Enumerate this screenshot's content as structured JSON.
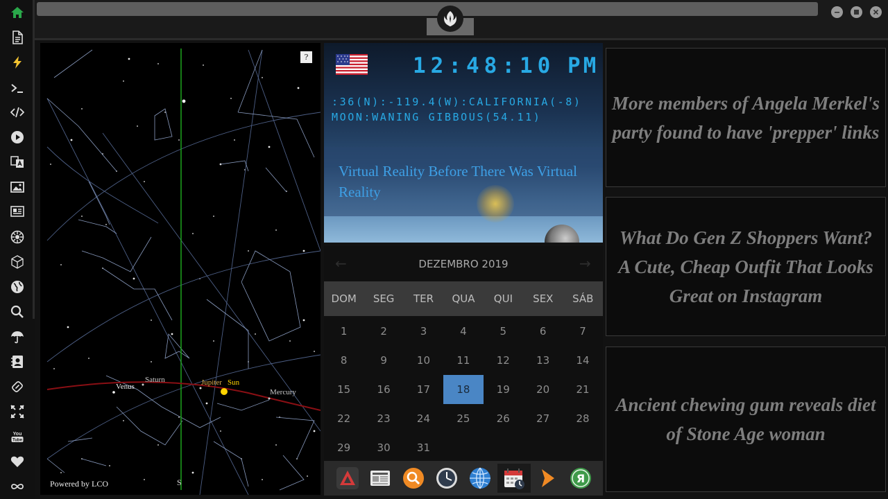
{
  "sidebar": {
    "icons": [
      "home-icon",
      "file-icon",
      "bolt-icon",
      "terminal-icon",
      "code-icon",
      "play-icon",
      "translate-icon",
      "image-icon",
      "news-icon",
      "settings-icon",
      "cube-icon",
      "globe-icon",
      "search-icon",
      "umbrella-icon",
      "contact-icon",
      "link-icon",
      "expand-icon",
      "youtube-icon",
      "heart-icon",
      "infinity-icon"
    ],
    "youtube_label": "You Tube"
  },
  "sky": {
    "help": "?",
    "powered": "Powered by LCO",
    "south": "S",
    "planets": [
      "Venus",
      "Saturn",
      "Jupiter",
      "Sun",
      "Mercury"
    ]
  },
  "clock": {
    "time": "12:48:10",
    "ampm": "PM",
    "location": ":36(N):-119.4(W):CALIFORNIA(-8)",
    "moon": "MOON:WANING GIBBOUS(54.11)",
    "article": "Virtual Reality Before There Was Virtual Reality"
  },
  "calendar": {
    "prev": "←",
    "next": "→",
    "month": "DEZEMBRO 2019",
    "weekdays": [
      "DOM",
      "SEG",
      "TER",
      "QUA",
      "QUI",
      "SEX",
      "SÁB"
    ],
    "weeks": [
      [
        "1",
        "2",
        "3",
        "4",
        "5",
        "6",
        "7"
      ],
      [
        "8",
        "9",
        "10",
        "11",
        "12",
        "13",
        "14"
      ],
      [
        "15",
        "16",
        "17",
        "18",
        "19",
        "20",
        "21"
      ],
      [
        "22",
        "23",
        "24",
        "25",
        "26",
        "27",
        "28"
      ],
      [
        "29",
        "30",
        "31",
        "",
        "",
        "",
        ""
      ]
    ],
    "today": "18"
  },
  "dock": {
    "apps": [
      "triangle-app-icon",
      "news-reader-icon",
      "search-app-icon",
      "clock-app-icon",
      "globe-app-icon",
      "calendar-app-icon",
      "arrow-app-icon",
      "yandex-app-icon"
    ],
    "yandex_letter": "Я",
    "active": "calendar-app-icon"
  },
  "news": [
    "More members of Angela Merkel's party found to have 'prepper' links",
    "What Do Gen Z Shoppers Want? A Cute, Cheap Outfit That Looks Great on Instagram",
    "Ancient chewing gum reveals diet of Stone Age woman"
  ],
  "colors": {
    "accent_green": "#2aa84a",
    "clock_blue": "#28a9e4",
    "today_blue": "#4a86c5",
    "ecliptic": "#8a0f14",
    "sun": "#ffd400"
  }
}
